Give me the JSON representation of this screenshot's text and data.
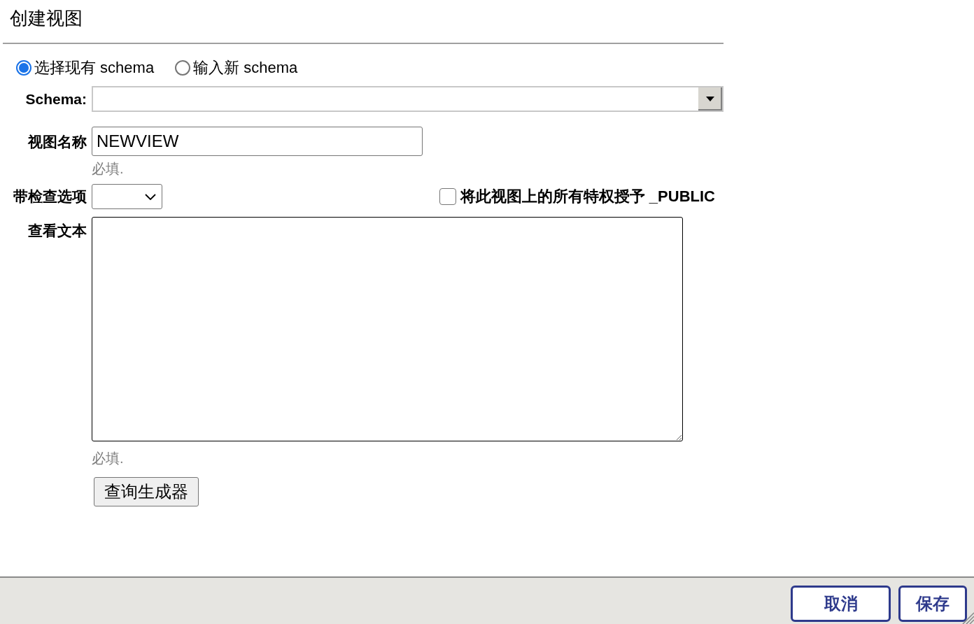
{
  "title": "创建视图",
  "schema_mode": [
    {
      "label": "选择现有 schema",
      "selected": true
    },
    {
      "label": "输入新 schema",
      "selected": false
    }
  ],
  "schema": {
    "label": "Schema:"
  },
  "view_name": {
    "label": "视图名称",
    "value": "NEWVIEW",
    "hint": "必填."
  },
  "check_option": {
    "label": "带检查选项"
  },
  "grant": {
    "label": "将此视图上的所有特权授予 _PUBLIC",
    "checked": false
  },
  "view_text": {
    "label": "查看文本",
    "hint": "必填."
  },
  "query_builder_button": "查询生成器",
  "footer_buttons": [
    "取消",
    "保存"
  ]
}
